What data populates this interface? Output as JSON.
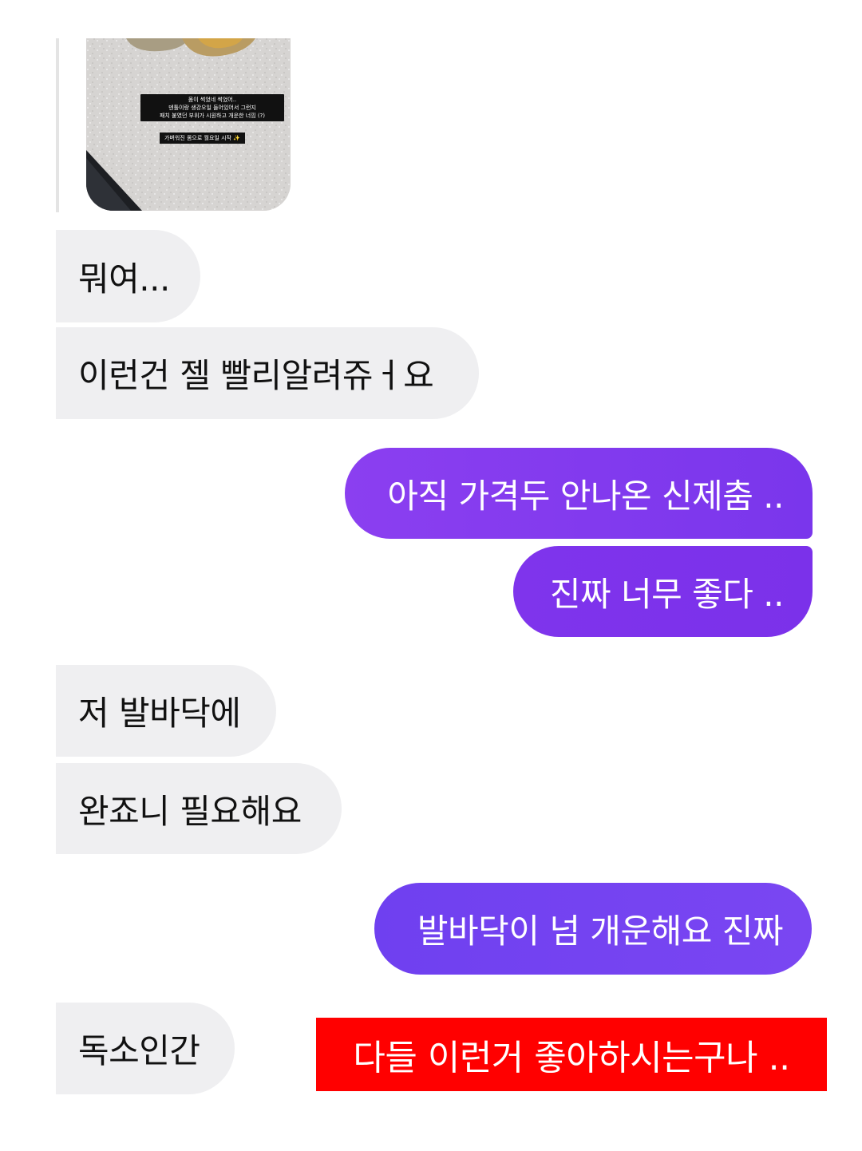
{
  "story_reply": {
    "caption_lines": [
      "몸이 썩었네 썩었어..",
      "덴톨이랑 생강오일 들어있어서 그런지",
      "패치 붙였던 부위가 시원하고 개운한 너낌 (?)"
    ],
    "tag": "가벼워진 몸으로 월요일 시작 ✨"
  },
  "messages": [
    {
      "side": "in",
      "text": "뭐여..."
    },
    {
      "side": "in",
      "text": "이런건 젤 빨리알려쥬ㅓ요"
    },
    {
      "side": "out",
      "text": "아직 가격두 안나온 신제춤 .."
    },
    {
      "side": "out",
      "text": "진짜 너무 좋다 .."
    },
    {
      "side": "in",
      "text": "저 발바닥에"
    },
    {
      "side": "in",
      "text": "완죠니 필요해요"
    },
    {
      "side": "out",
      "text": "발바닥이 넘 개운해요 진짜"
    },
    {
      "side": "in",
      "text": "독소인간"
    }
  ],
  "overlay_caption": "다들 이런거 좋아하시는구나 ..",
  "colors": {
    "incoming_bubble": "#efeff1",
    "outgoing_bubble": "#7b3bef",
    "overlay_caption_bg": "#ff0000"
  }
}
